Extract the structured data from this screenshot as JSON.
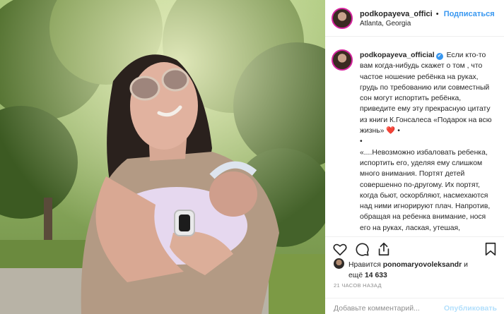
{
  "post": {
    "username": "podkopayeva_offici",
    "follow_label": "Подписаться",
    "separator": "•",
    "location": "Atlanta, Georgia"
  },
  "caption": {
    "username": "podkopayeva_official",
    "verified_mark": "✔",
    "lines": [
      "Если кто-то вам когда-нибудь скажет о том , что частое ношение ребёнка на руках, грудь по требованию или совместный сон могут испортить ребёнка, приведите ему эту прекрасную цитату из книги К.Гонсалеса «Подарок на всю жизнь»",
      "•",
      "«....Невозможно избаловать ребенка, испортить его, уделяя ему слишком много внимания. Портят детей совершенно по-другому. Их портят, когда бьют, оскорбляют, насмехаются над ними игнорируют плач. Напротив, обращая на ребенка внимание, нося его на руках, лаская, утешая, разговаривая"
    ],
    "heart": "❤️",
    "trail_dot": "•"
  },
  "icons": {
    "like": "heart-outline-icon",
    "comment": "comment-bubble-icon",
    "share": "share-upload-icon",
    "save": "bookmark-icon"
  },
  "likes": {
    "prefix": "Нравится",
    "user": "ponomaryovoleksandr",
    "conj": "и",
    "more_prefix": "ещё",
    "count": "14 633"
  },
  "timestamp": "21 часов назад",
  "comment_box": {
    "placeholder": "Добавьте комментарий...",
    "publish_label": "Опубликовать"
  },
  "colors": {
    "link_blue": "#3897f0",
    "publish_disabled": "#b2dffc",
    "verified": "#3897f0",
    "muted": "#8e8e8e"
  }
}
